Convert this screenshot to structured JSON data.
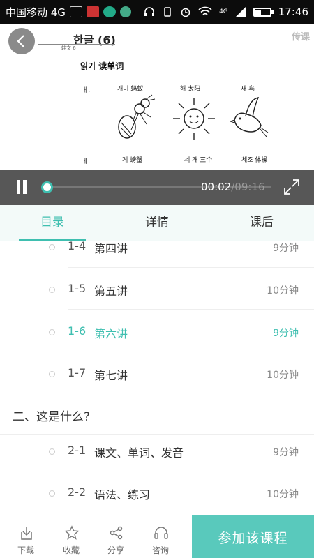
{
  "status_bar": {
    "carrier": "中国移动 4G",
    "time": "17:46",
    "network": "4G",
    "icons": [
      "sim-icon",
      "image-icon",
      "app-icon",
      "app-icon",
      "headset-icon",
      "vibrate-icon",
      "alarm-icon",
      "wifi-icon",
      "signal-icon",
      "battery-icon"
    ]
  },
  "video": {
    "doc_title": "한글 (6)",
    "doc_sub": "韩文 6",
    "watermark": "传课",
    "lesson_heading": "읽기  读单词",
    "row1": {
      "label": "ㅐ.",
      "words": [
        "개미  蚂蚁",
        "해  太阳",
        "새  鸟"
      ]
    },
    "row2": {
      "label": "ㅔ.",
      "words": [
        "게  螃蟹",
        "세 개  三个",
        "체조  体操"
      ]
    },
    "current_time": "00:02",
    "separator": "/",
    "total_time": "09:16",
    "progress": 0.0036
  },
  "tabs": [
    "目录",
    "详情",
    "课后"
  ],
  "active_tab": 0,
  "list": {
    "items": [
      {
        "num": "1-4",
        "name": "第四讲",
        "duration": "9分钟",
        "active": false
      },
      {
        "num": "1-5",
        "name": "第五讲",
        "duration": "10分钟",
        "active": false
      },
      {
        "num": "1-6",
        "name": "第六讲",
        "duration": "9分钟",
        "active": true
      },
      {
        "num": "1-7",
        "name": "第七讲",
        "duration": "10分钟",
        "active": false
      }
    ],
    "section2_title": "二、这是什么?",
    "section2_items": [
      {
        "num": "2-1",
        "name": "课文、单词、发音",
        "duration": "9分钟",
        "active": false
      },
      {
        "num": "2-2",
        "name": "语法、练习",
        "duration": "10分钟",
        "active": false
      }
    ]
  },
  "bottom_bar": {
    "download": "下载",
    "favorite": "收藏",
    "share": "分享",
    "consult": "咨询",
    "join": "参加该课程"
  },
  "colors": {
    "accent": "#3fbfb0",
    "join_bg": "#59c9bc"
  }
}
